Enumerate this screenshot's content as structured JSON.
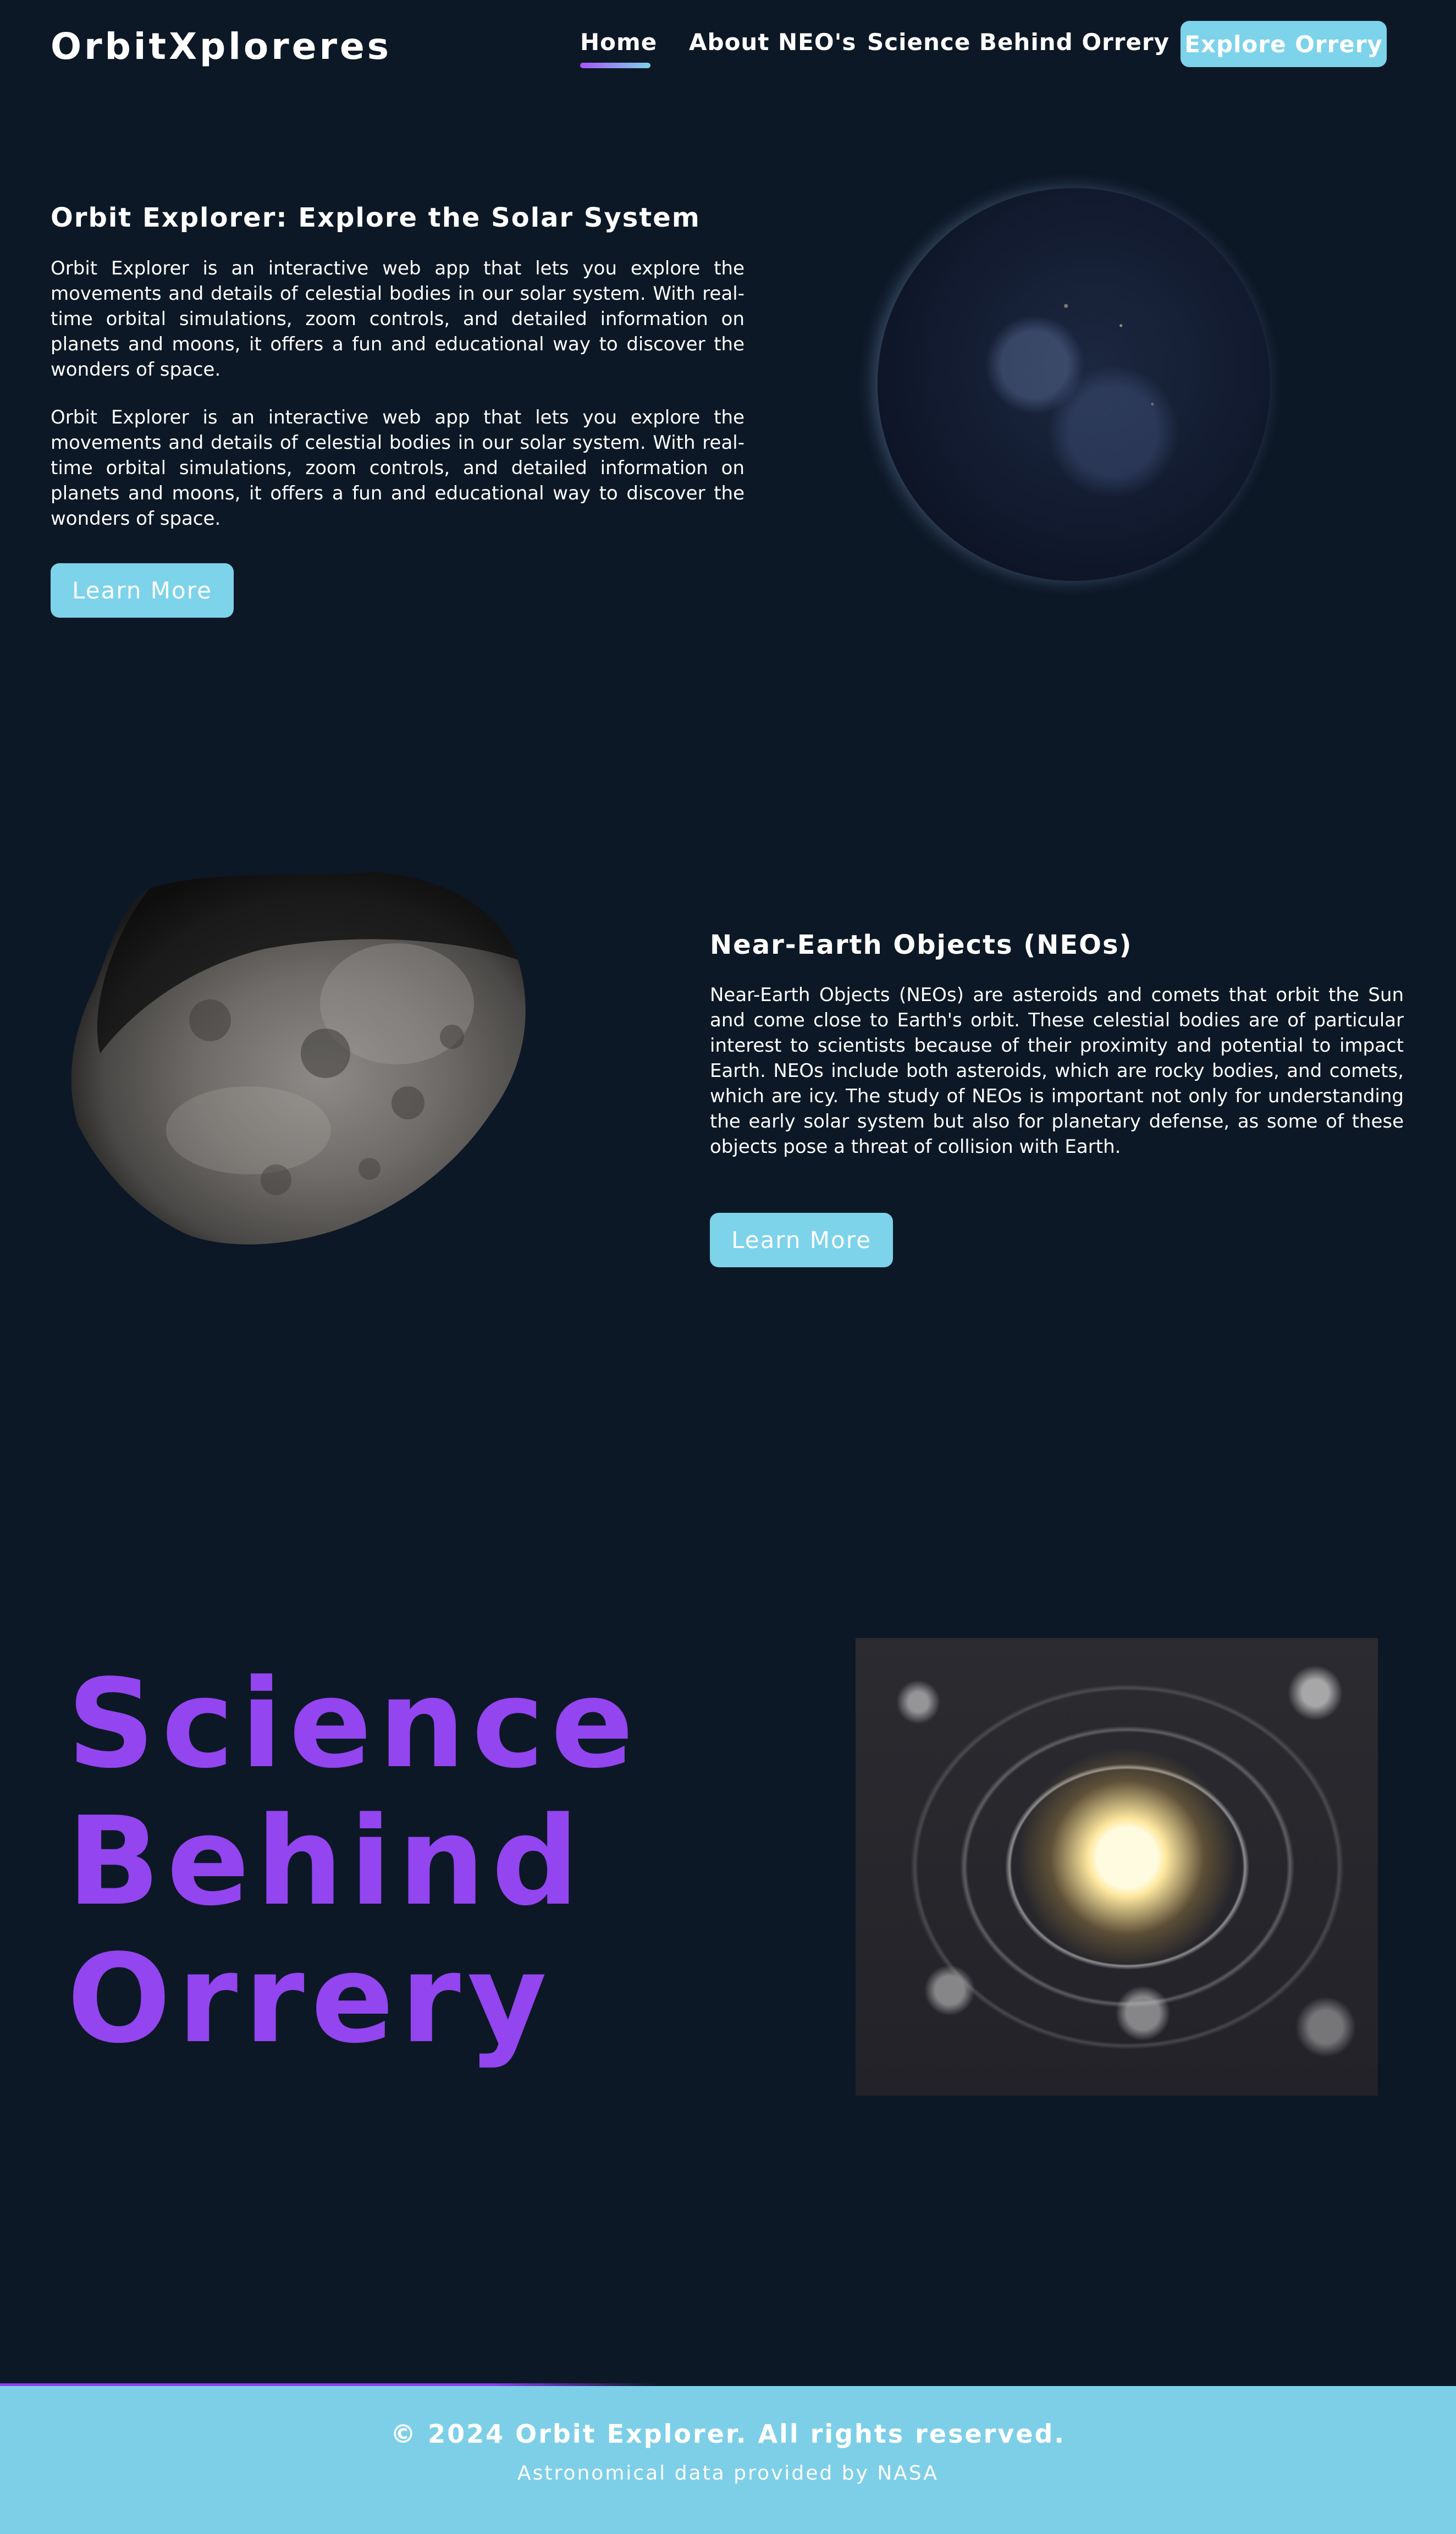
{
  "header": {
    "logo": "OrbitXploreres",
    "nav": {
      "home": "Home",
      "about_neos": "About NEO's",
      "science": "Science Behind Orrery",
      "cta": "Explore Orrery"
    },
    "active_nav": "Home"
  },
  "hero": {
    "title": "Orbit Explorer: Explore the Solar System",
    "paragraphs": [
      "Orbit Explorer is an interactive web app that lets you explore the movements and details of celestial bodies in our solar system. With real-time orbital simulations, zoom controls, and detailed information on planets and moons, it offers a fun and educational way to discover the wonders of space.",
      "Orbit Explorer is an interactive web app that lets you explore the movements and details of celestial bodies in our solar system. With real-time orbital simulations, zoom controls, and detailed information on planets and moons, it offers a fun and educational way to discover the wonders of space."
    ],
    "button": "Learn More"
  },
  "neo": {
    "title": "Near-Earth Objects (NEOs)",
    "paragraph": "Near-Earth Objects (NEOs) are asteroids and comets that orbit the Sun and come close to Earth's orbit. These celestial bodies are of particular interest to scientists because of their proximity and potential to impact Earth. NEOs include both asteroids, which are rocky bodies, and comets, which are icy. The study of NEOs is important not only for understanding the early solar system but also for planetary defense, as some of these objects pose a threat of collision with Earth.",
    "button": "Learn More"
  },
  "science": {
    "title_lines": [
      "Science",
      "Behind",
      "Orrery"
    ]
  },
  "footer": {
    "copyright": "© 2024 Orbit Explorer. All rights reserved.",
    "credit": "Astronomical data provided by NASA"
  },
  "colors": {
    "background": "#0d1826",
    "accent_cyan": "#7dd3ea",
    "accent_purple": "#9345ef",
    "footer_background": "#7dcfe8"
  },
  "icons": {
    "earth": "earth-image",
    "asteroid": "asteroid-image",
    "orrery": "orrery-image"
  }
}
